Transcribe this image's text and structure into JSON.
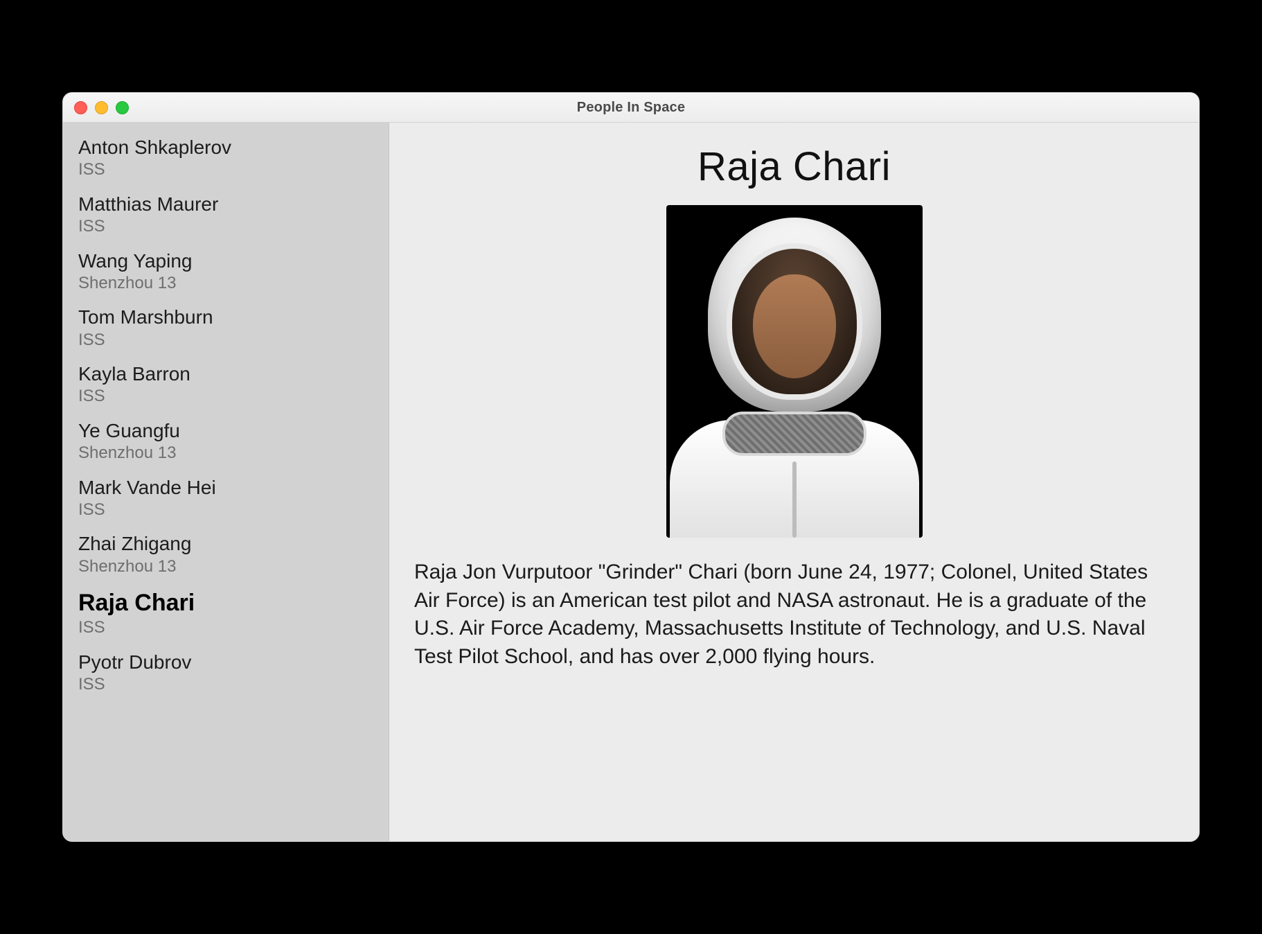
{
  "window": {
    "title": "People In Space"
  },
  "sidebar": {
    "items": [
      {
        "name": "Anton Shkaplerov",
        "craft": "ISS",
        "selected": false
      },
      {
        "name": "Matthias Maurer",
        "craft": "ISS",
        "selected": false
      },
      {
        "name": "Wang Yaping",
        "craft": "Shenzhou 13",
        "selected": false
      },
      {
        "name": "Tom Marshburn",
        "craft": "ISS",
        "selected": false
      },
      {
        "name": "Kayla Barron",
        "craft": "ISS",
        "selected": false
      },
      {
        "name": "Ye Guangfu",
        "craft": "Shenzhou 13",
        "selected": false
      },
      {
        "name": "Mark Vande Hei",
        "craft": "ISS",
        "selected": false
      },
      {
        "name": "Zhai Zhigang",
        "craft": "Shenzhou 13",
        "selected": false
      },
      {
        "name": "Raja Chari",
        "craft": "ISS",
        "selected": true
      },
      {
        "name": "Pyotr Dubrov",
        "craft": "ISS",
        "selected": false
      }
    ]
  },
  "detail": {
    "name": "Raja Chari",
    "bio": "Raja Jon Vurputoor \"Grinder\" Chari (born June 24, 1977; Colonel, United States Air Force) is an American test pilot and NASA astronaut. He is a graduate of the U.S. Air Force Academy, Massachusetts Institute of Technology, and U.S. Naval Test Pilot School, and has over 2,000 flying hours."
  }
}
